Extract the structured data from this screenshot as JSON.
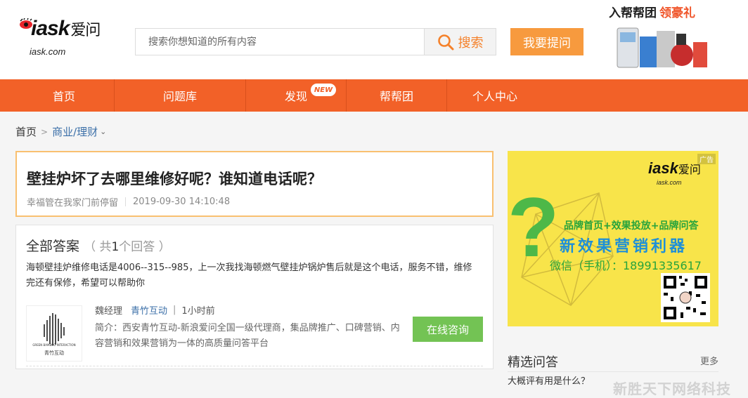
{
  "header": {
    "logo": {
      "brand": "iask",
      "brand_cn": "爱问",
      "domain": "iask.com"
    },
    "search": {
      "placeholder": "搜索你想知道的所有内容",
      "button_label": "搜索"
    },
    "ask_button": "我要提问",
    "promo": {
      "title": "入帮帮团",
      "highlight": "领豪礼"
    }
  },
  "nav": {
    "items": [
      {
        "label": "首页"
      },
      {
        "label": "问题库"
      },
      {
        "label": "发现"
      },
      {
        "label": "帮帮团"
      },
      {
        "label": "个人中心"
      }
    ],
    "badge": "NEW"
  },
  "breadcrumb": {
    "home": "首页",
    "separator": ">",
    "category": "商业/理财"
  },
  "question": {
    "title": "壁挂炉坏了去哪里维修好呢？谁知道电话呢？",
    "asker": "幸福管在我家门前停留",
    "time": "2019-09-30 14:10:48"
  },
  "answers": {
    "heading": "全部答案",
    "count_prefix": "（ 共",
    "count": "1",
    "count_suffix": "个回答 ）",
    "items": [
      {
        "content": "海顿壁挂炉维修电话是4006--315--985，上一次我找海顿燃气壁挂炉锅炉售后就是这个电话，服务不错，维修完还有保修，希望可以帮助你",
        "author": "魏经理",
        "org": "青竹互动",
        "time": "1小时前",
        "intro": "简介：西安青竹互动-新浪爱问全国一级代理商，集品牌推广、口碑营销、内容营销和效果营销为一体的高质量问答平台",
        "avatar_caption_en": "GREEN BAMBOO INTERACTION",
        "avatar_caption_cn": "青竹互动",
        "consult_button": "在线咨询"
      }
    ]
  },
  "ad": {
    "tag": "广告",
    "logo": "iask",
    "logo_cn": "爱问",
    "domain": "iask.com",
    "line1": "品牌首页+效果投放+品牌问答",
    "line2": "新效果营销利器",
    "line3": "微信（手机）：18991335617"
  },
  "picks": {
    "title": "精选问答",
    "more": "更多",
    "first_item_partial": "大概评有用是什么？"
  },
  "watermark": "新胜天下网络科技",
  "colors": {
    "nav": "#f26128",
    "ask_button": "#f79a3e",
    "consult": "#73c354",
    "ad_bg": "#f8e44a",
    "link": "#3b6fa8"
  }
}
